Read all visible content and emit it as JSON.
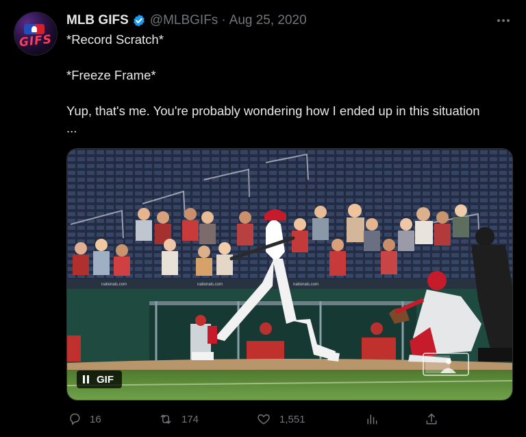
{
  "tweet": {
    "display_name": "MLB GIFS",
    "handle": "@MLBGIFs",
    "separator": "·",
    "date": "Aug 25, 2020",
    "avatar_text": "GIFS",
    "text_lines": [
      "*Record Scratch*",
      "*Freeze Frame*",
      "Yup, that's me. You're probably wondering how I ended up in this situation",
      "..."
    ]
  },
  "media": {
    "badge_label": "GIF",
    "play_state": "pause-icon"
  },
  "actions": {
    "replies": "16",
    "retweets": "174",
    "likes": "1,551"
  },
  "colors": {
    "background": "#000000",
    "text": "#e7e9ea",
    "secondary": "#71767b",
    "verified": "#1d9bf0"
  }
}
